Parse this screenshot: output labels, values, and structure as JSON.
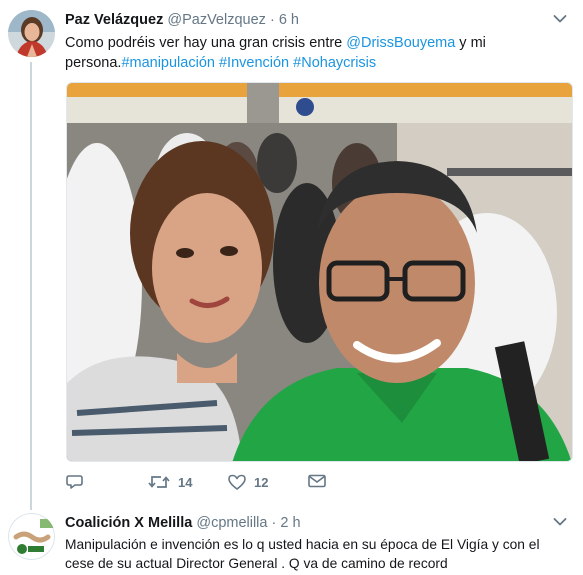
{
  "tweets": [
    {
      "author_name": "Paz Velázquez",
      "handle": "@PazVelzquez",
      "separator": "·",
      "time": "6 h",
      "text_part1": "Como podréis ver hay una gran crisis entre ",
      "mention": "@DrissBouyema",
      "text_part2": " y mi persona.",
      "hashtags": [
        "#manipulación",
        "#Invención",
        "#Nohaycrisis"
      ],
      "photo_icon": "selfie-photo",
      "actions": {
        "reply_icon": "reply-icon",
        "retweet_icon": "retweet-icon",
        "retweet_count": "14",
        "like_icon": "heart-icon",
        "like_count": "12",
        "dm_icon": "envelope-icon"
      }
    },
    {
      "author_name": "Coalición X Melilla",
      "handle": "@cpmelilla",
      "separator": "·",
      "time": "2 h",
      "text": "Manipulación e invención es lo q usted hacia en su época de El Vigía y con el cese de su actual Director General . Q va de camino de record"
    }
  ],
  "colors": {
    "link": "#1b95e0",
    "secondary_text": "#657786",
    "thread_line": "#ccd6dd"
  }
}
